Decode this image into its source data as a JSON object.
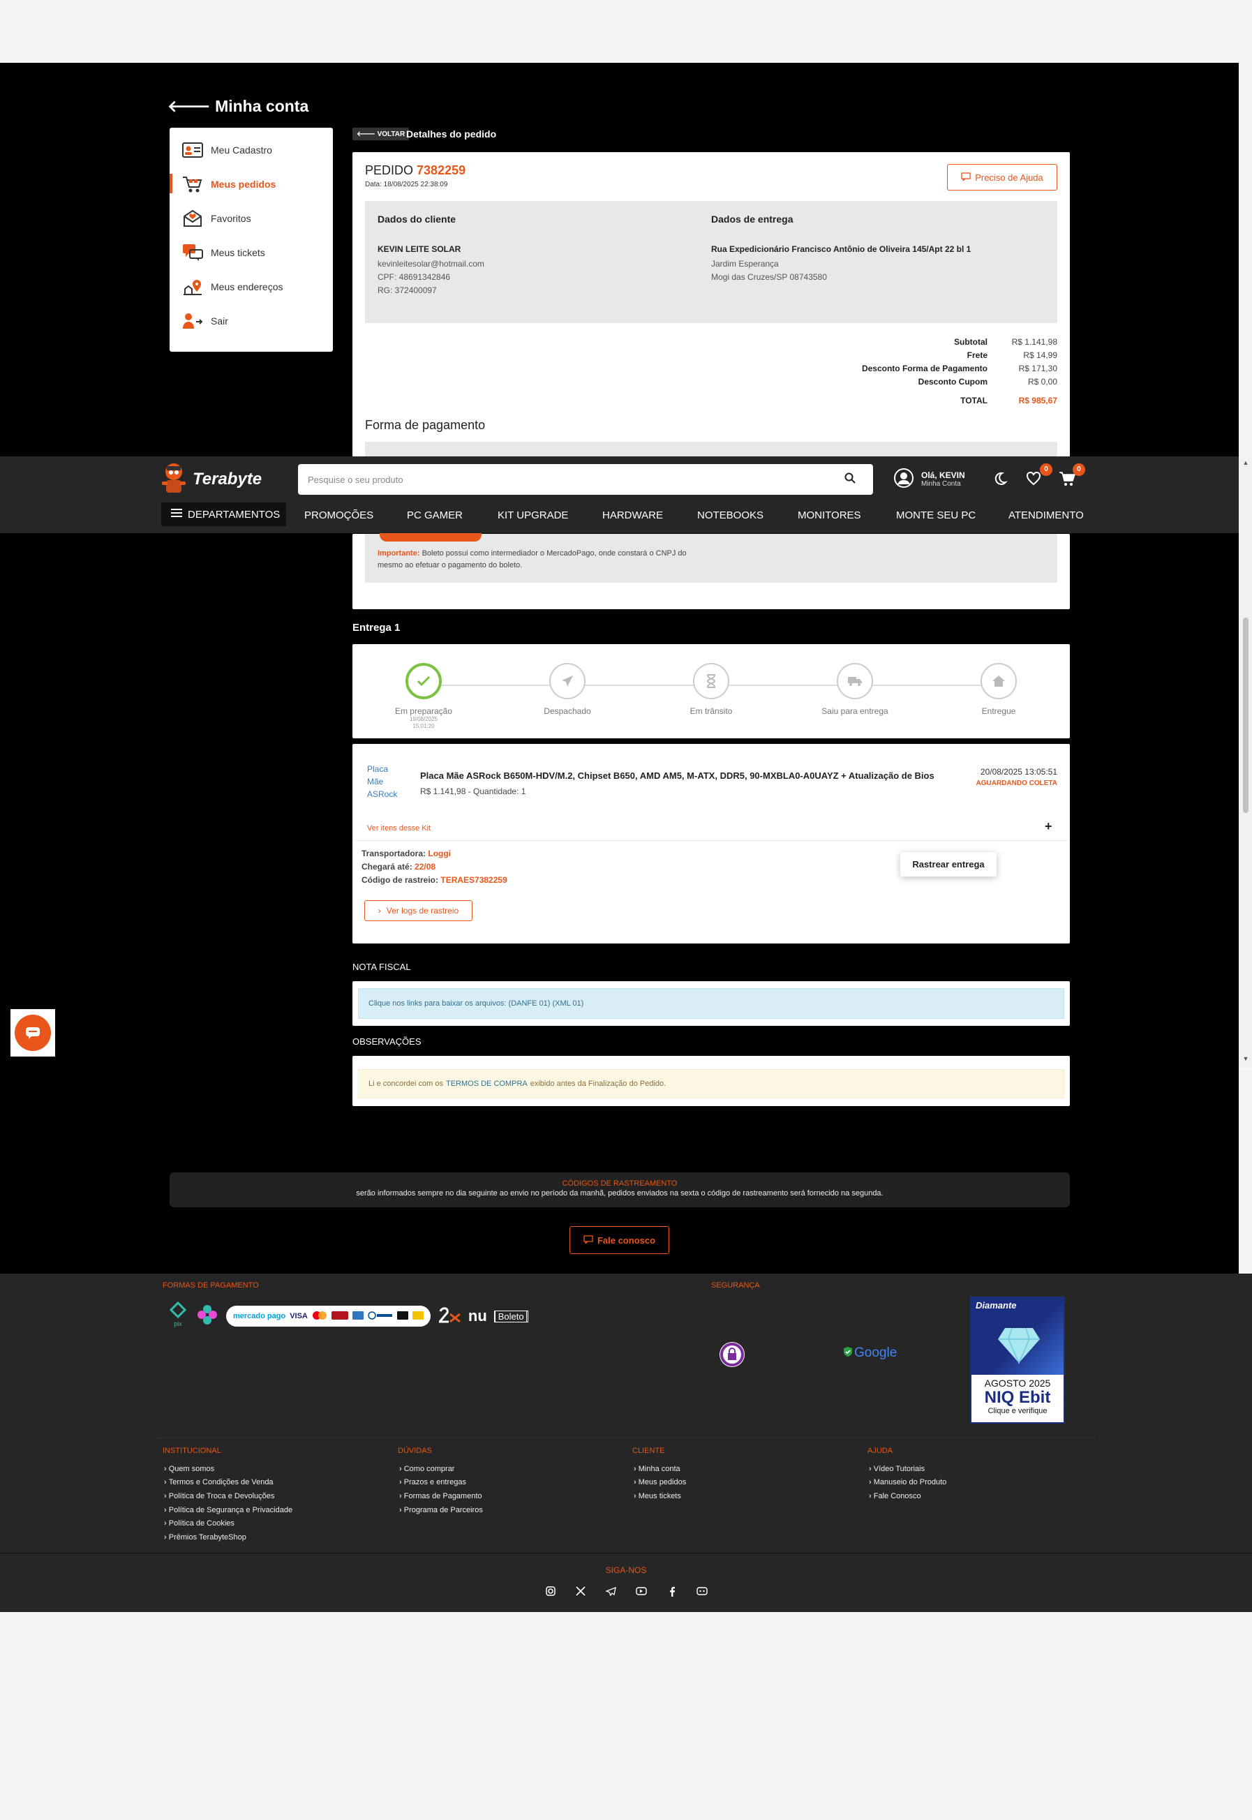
{
  "account": {
    "title": "Minha conta"
  },
  "sidebar": {
    "items": [
      {
        "label": "Meu Cadastro",
        "icon": "id-card-icon"
      },
      {
        "label": "Meus pedidos",
        "icon": "cart-icon",
        "active": true
      },
      {
        "label": "Favoritos",
        "icon": "heart-envelope-icon"
      },
      {
        "label": "Meus tickets",
        "icon": "chat-bubbles-icon"
      },
      {
        "label": "Meus endereços",
        "icon": "map-pin-icon"
      },
      {
        "label": "Sair",
        "icon": "logout-user-icon"
      }
    ]
  },
  "order": {
    "back_label": "VOLTAR",
    "details_title": "Detalhes do pedido",
    "pedido_label": "PEDIDO",
    "pedido_number": "7382259",
    "date": "Data: 18/08/2025 22:38:09",
    "help_label": "Preciso de Ajuda",
    "client": {
      "heading": "Dados do cliente",
      "name": "KEVIN LEITE SOLAR",
      "email": "kevinleitesolar@hotmail.com",
      "cpf": "CPF: 48691342846",
      "rg": "RG: 372400097"
    },
    "delivery": {
      "heading": "Dados de entrega",
      "street": "Rua Expedicionário Francisco Antônio de Oliveira 145/Apt 22 bl 1",
      "district": "Jardim Esperança",
      "city": "Mogi das Cruzes/SP 08743580"
    },
    "summary": [
      {
        "label": "Subtotal",
        "value": "R$ 1.141,98"
      },
      {
        "label": "Frete",
        "value": "R$ 14,99"
      },
      {
        "label": "Desconto Forma de Pagamento",
        "value": "R$ 171,30"
      },
      {
        "label": "Desconto Cupom",
        "value": "R$ 0,00"
      }
    ],
    "total_label": "TOTAL",
    "total_value": "R$ 985,67",
    "payment_title": "Forma de pagamento",
    "boleto_note_bold": "Importante:",
    "boleto_note": "Boleto possui como intermediador o MercadoPago, onde constará o CNPJ do mesmo ao efetuar o pagamento do boleto."
  },
  "header": {
    "logo_text": "Terabyte",
    "search_placeholder": "Pesquise o seu produto",
    "user_greet": "Olá, KEVIN",
    "user_sub": "Minha Conta",
    "favorites_count": "0",
    "cart_count": "0",
    "departments_label": "DEPARTAMENTOS",
    "nav": [
      "PROMOÇÕES",
      "PC GAMER",
      "KIT UPGRADE",
      "HARDWARE",
      "NOTEBOOKS",
      "MONITORES",
      "MONTE SEU PC",
      "ATENDIMENTO"
    ]
  },
  "shipment": {
    "title": "Entrega 1",
    "steps": [
      {
        "label": "Em preparação",
        "date": "19/08/2025",
        "time": "15:01:20",
        "icon": "check-icon",
        "done": true
      },
      {
        "label": "Despachado",
        "icon": "paper-plane-icon"
      },
      {
        "label": "Em trânsito",
        "icon": "hourglass-icon"
      },
      {
        "label": "Saiu para entrega",
        "icon": "truck-icon"
      },
      {
        "label": "Entregue",
        "icon": "home-icon"
      }
    ],
    "product": {
      "img_alt": "Placa Mãe ASRock",
      "name": "Placa Mãe ASRock B650M-HDV/M.2, Chipset B650, AMD AM5, M-ATX, DDR5, 90-MXBLA0-A0UAYZ + Atualização de Bios",
      "price": "R$ 1.141,98 - Quantidade: 1",
      "date": "20/08/2025 13:05:51",
      "status": "AGUARDANDO COLETA"
    },
    "kit_link": "Ver itens desse Kit",
    "kit_toggle": "+",
    "carrier_label": "Transportadora:",
    "carrier": "Loggi",
    "arrival_label": "Chegará até:",
    "arrival": "22/08",
    "tracking_label": "Código de rastreio:",
    "tracking": "TERAES7382259",
    "track_button": "Rastrear entrega",
    "logs_button": "Ver logs de rastreio"
  },
  "invoice": {
    "title": "NOTA FISCAL",
    "text": "Clique nos links para baixar os arquivos: (DANFE 01) (XML 01)"
  },
  "observations": {
    "title": "OBSERVAÇÕES",
    "pre": "Li e concordei com os",
    "link": "TERMOS DE COMPRA",
    "post": "exibido antes da Finalização do Pedido."
  },
  "tracking_info": {
    "title": "CÓDIGOS DE RASTREAMENTO",
    "text": "serão informados sempre no dia seguinte ao envio no período da manhã, pedidos enviados na sexta o código de rastreamento será fornecido na segunda."
  },
  "contact_button": "Fale conosco",
  "footer": {
    "payment_heading": "FORMAS DE PAGAMENTO",
    "payment_logos": [
      "pix",
      "mercado pago",
      "VISA",
      "nu",
      "Boleto"
    ],
    "security_heading": "SEGURANÇA",
    "google_badge": "Google",
    "ebit": {
      "tier": "Diamante",
      "date": "AGOSTO 2025",
      "brand": "NIQ Ebit",
      "cta": "Clique e verifique"
    },
    "columns": [
      {
        "heading": "INSTITUCIONAL",
        "links": [
          "Quem somos",
          "Termos e Condições de Venda",
          "Política de Troca e Devoluções",
          "Política de Segurança e Privacidade",
          "Política de Cookies",
          "Prêmios TerabyteShop"
        ]
      },
      {
        "heading": "DÚVIDAS",
        "links": [
          "Como comprar",
          "Prazos e entregas",
          "Formas de Pagamento",
          "Programa de Parceiros"
        ]
      },
      {
        "heading": "CLIENTE",
        "links": [
          "Minha conta",
          "Meus pedidos",
          "Meus tickets"
        ]
      },
      {
        "heading": "AJUDA",
        "links": [
          "Vídeo Tutoriais",
          "Manuseio do Produto",
          "Fale Conosco"
        ]
      }
    ],
    "social_heading": "SIGA-NOS",
    "social_icons": [
      "instagram-icon",
      "x-icon",
      "telegram-icon",
      "youtube-icon",
      "facebook-icon",
      "discord-icon"
    ]
  },
  "colors": {
    "accent": "#e8561a",
    "header_bg": "#262626",
    "page_bg": "#000000",
    "success": "#7cc142"
  }
}
